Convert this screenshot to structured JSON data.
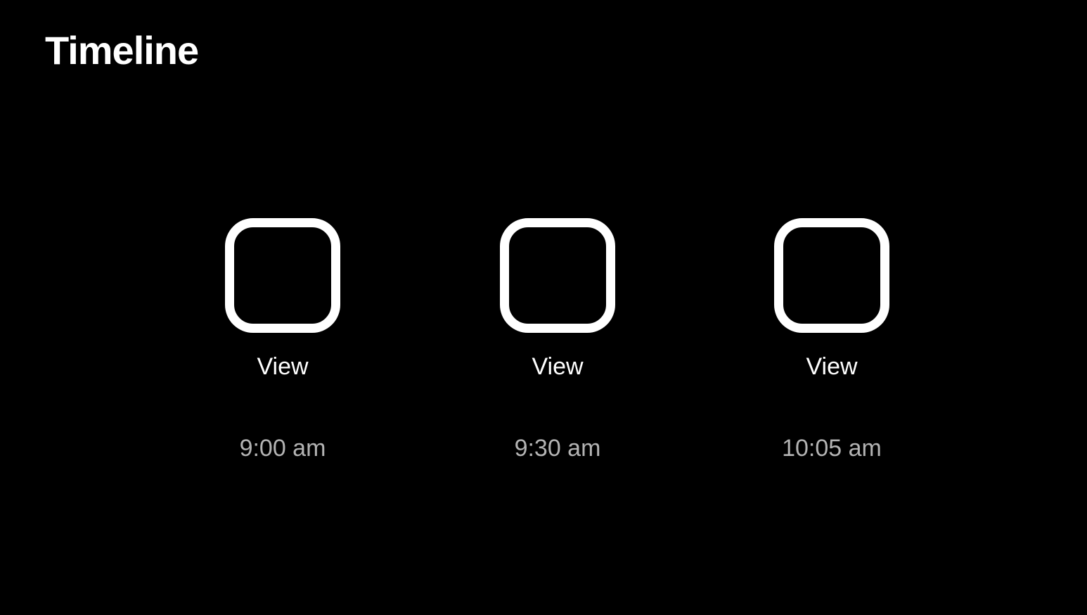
{
  "title": "Timeline",
  "entries": [
    {
      "label": "View",
      "time": "9:00 am"
    },
    {
      "label": "View",
      "time": "9:30 am"
    },
    {
      "label": "View",
      "time": "10:05 am"
    }
  ],
  "colors": {
    "background": "#000000",
    "primary_text": "#ffffff",
    "secondary_text": "#b3b3b3",
    "box_stroke": "#ffffff"
  }
}
